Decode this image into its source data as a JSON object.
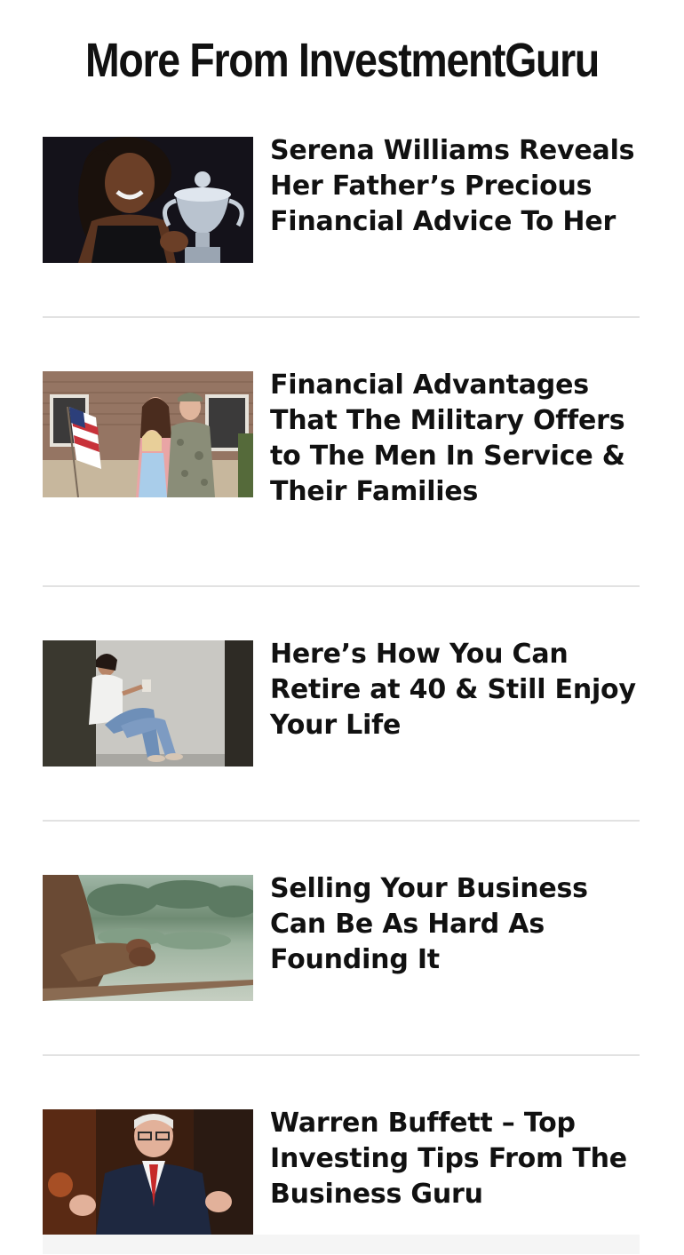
{
  "section": {
    "heading": "More From InvestmentGuru"
  },
  "articles": [
    {
      "title": "Serena Williams Reveals Her Father’s Precious Financial Advice To Her",
      "image": "serena-williams-trophy-photo"
    },
    {
      "title": "Financial Advantages That The Military Offers to The Men In Service & Their Families",
      "image": "military-family-flag-photo"
    },
    {
      "title": "Here’s How You Can Retire at 40 & Still Enjoy Your Life",
      "image": "woman-sitting-coffee-photo"
    },
    {
      "title": "Selling Your Business Can Be As Hard As Founding It",
      "image": "hands-lake-view-photo"
    },
    {
      "title": "Warren Buffett – Top Investing Tips From The Business Guru",
      "image": "warren-buffett-photo"
    }
  ]
}
